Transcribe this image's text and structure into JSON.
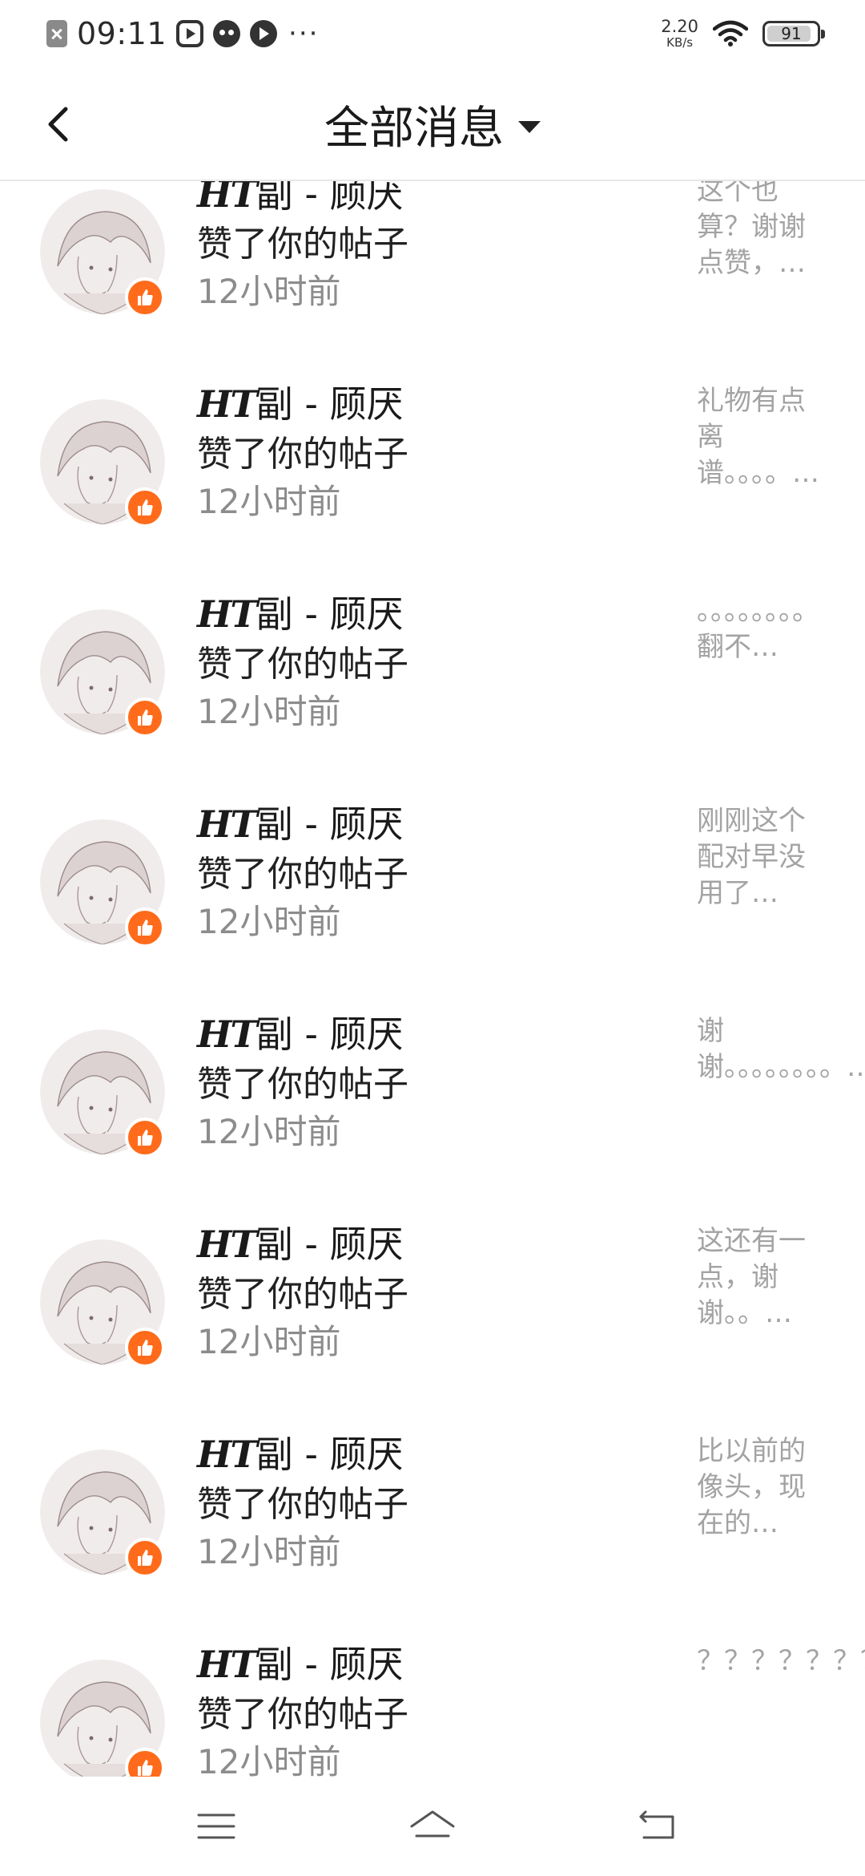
{
  "status_bar": {
    "time": "09:11",
    "net_speed_value": "2.20",
    "net_speed_unit": "KB/s",
    "battery_level": "91",
    "battery_fraction": 0.91,
    "overflow": "···"
  },
  "header": {
    "title": "全部消息",
    "back_icon": "chevron-left-icon",
    "filter_icon": "caret-down-icon"
  },
  "messages": [
    {
      "name_gothic": "HT",
      "name": "副 - 顾厌",
      "action": "赞了你的帖子",
      "time": "12小时前",
      "preview": "这个也算？谢谢点赞，…"
    },
    {
      "name_gothic": "HT",
      "name": "副 - 顾厌",
      "action": "赞了你的帖子",
      "time": "12小时前",
      "preview": "礼物有点离谱。。。。…"
    },
    {
      "name_gothic": "HT",
      "name": "副 - 顾厌",
      "action": "赞了你的帖子",
      "time": "12小时前",
      "preview": "。。。。。。。。翻不…"
    },
    {
      "name_gothic": "HT",
      "name": "副 - 顾厌",
      "action": "赞了你的帖子",
      "time": "12小时前",
      "preview": "刚刚这个配对早没用了…"
    },
    {
      "name_gothic": "HT",
      "name": "副 - 顾厌",
      "action": "赞了你的帖子",
      "time": "12小时前",
      "preview": "谢谢。。。。。。。。…"
    },
    {
      "name_gothic": "HT",
      "name": "副 - 顾厌",
      "action": "赞了你的帖子",
      "time": "12小时前",
      "preview": "这还有一点，谢谢。。…"
    },
    {
      "name_gothic": "HT",
      "name": "副 - 顾厌",
      "action": "赞了你的帖子",
      "time": "12小时前",
      "preview": "比以前的像头，现在的…"
    },
    {
      "name_gothic": "HT",
      "name": "副 - 顾厌",
      "action": "赞了你的帖子",
      "time": "12小时前",
      "preview": "？？？？？？？？？？…"
    }
  ],
  "nav_bar": {
    "menu_icon": "menu-icon",
    "home_icon": "home-icon",
    "back_icon": "return-icon"
  },
  "colors": {
    "accent": "#ff6b1a",
    "secondary_text": "#8c8c8c",
    "preview_text": "#a3a3a3"
  }
}
